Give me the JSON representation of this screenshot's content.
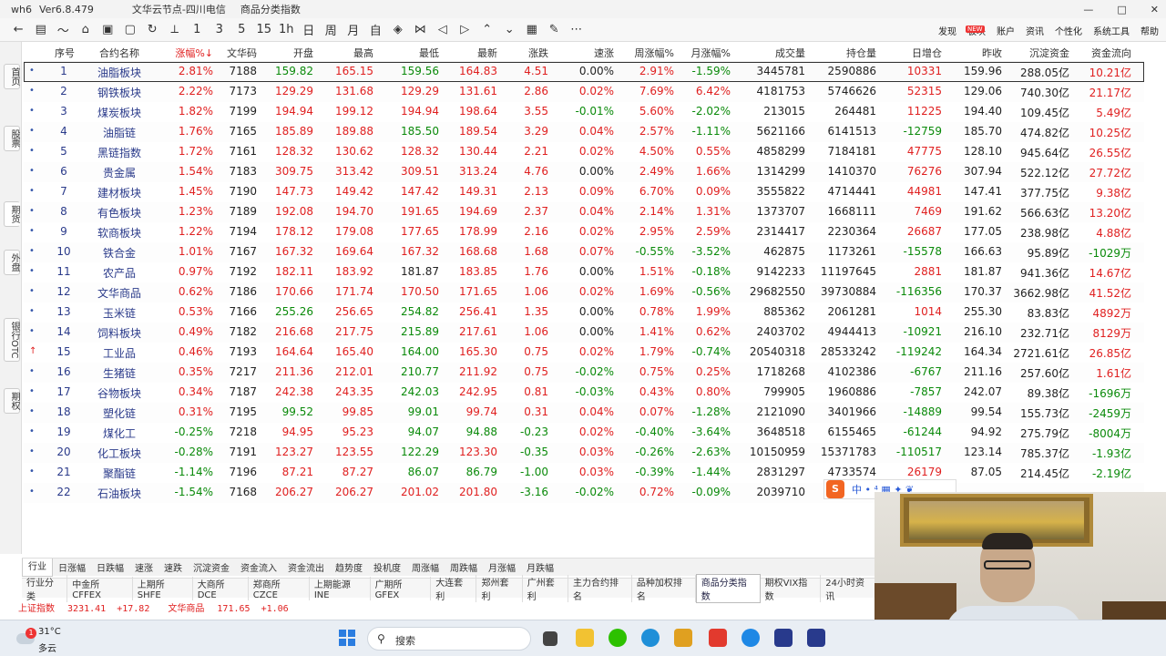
{
  "titlebar": {
    "app": "wh6",
    "version": "Ver6.8.479",
    "node": "文华云节点-四川电信",
    "page": "商品分类指数",
    "min": "—",
    "max": "□",
    "close": "✕"
  },
  "toolbar": {
    "icons": [
      "←",
      "▤",
      "〜",
      "⌂",
      "▣",
      "▢",
      "↻",
      "⟂",
      "1",
      "3",
      "5",
      "15",
      "1h",
      "日",
      "周",
      "月",
      "自",
      "◈",
      "⋈",
      "◁",
      "▷",
      "⌃",
      "⌄",
      "▦",
      "✎",
      "⋯"
    ],
    "right_menu": [
      "发现",
      "板块",
      "账户",
      "资讯",
      "个性化",
      "系统工具",
      "帮助"
    ],
    "badge": "NEW"
  },
  "left_tabs": [
    "首页",
    "股票",
    "期货",
    "外盘",
    "银行OTC",
    "期权"
  ],
  "columns": [
    "序号",
    "合约名称",
    "涨幅%↓",
    "文华码",
    "开盘",
    "最高",
    "最低",
    "最新",
    "涨跌",
    "速涨",
    "周涨幅%",
    "月涨幅%",
    "成交量",
    "持仓量",
    "日增仓",
    "昨收",
    "沉淀资金",
    "资金流向"
  ],
  "rows": [
    {
      "no": "1",
      "name": "油脂板块",
      "chg": "2.81%",
      "code": "7188",
      "open": "159.82",
      "high": "165.15",
      "low": "159.56",
      "last": "164.83",
      "diff": "4.51",
      "speed": "0.00%",
      "week": "2.91%",
      "month": "-1.59%",
      "vol": "3445781",
      "oi": "2590886",
      "doi": "10331",
      "prev": "159.96",
      "fund": "288.05亿",
      "flow": "10.21亿"
    },
    {
      "no": "2",
      "name": "钢铁板块",
      "chg": "2.22%",
      "code": "7173",
      "open": "129.29",
      "high": "131.68",
      "low": "129.29",
      "last": "131.61",
      "diff": "2.86",
      "speed": "0.02%",
      "week": "7.69%",
      "month": "6.42%",
      "vol": "4181753",
      "oi": "5746626",
      "doi": "52315",
      "prev": "129.06",
      "fund": "740.30亿",
      "flow": "21.17亿"
    },
    {
      "no": "3",
      "name": "煤炭板块",
      "chg": "1.82%",
      "code": "7199",
      "open": "194.94",
      "high": "199.12",
      "low": "194.94",
      "last": "198.64",
      "diff": "3.55",
      "speed": "-0.01%",
      "week": "5.60%",
      "month": "-2.02%",
      "vol": "213015",
      "oi": "264481",
      "doi": "11225",
      "prev": "194.40",
      "fund": "109.45亿",
      "flow": "5.49亿"
    },
    {
      "no": "4",
      "name": "油脂链",
      "chg": "1.76%",
      "code": "7165",
      "open": "185.89",
      "high": "189.88",
      "low": "185.50",
      "last": "189.54",
      "diff": "3.29",
      "speed": "0.04%",
      "week": "2.57%",
      "month": "-1.11%",
      "vol": "5621166",
      "oi": "6141513",
      "doi": "-12759",
      "prev": "185.70",
      "fund": "474.82亿",
      "flow": "10.25亿"
    },
    {
      "no": "5",
      "name": "黑链指数",
      "chg": "1.72%",
      "code": "7161",
      "open": "128.32",
      "high": "130.62",
      "low": "128.32",
      "last": "130.44",
      "diff": "2.21",
      "speed": "0.02%",
      "week": "4.50%",
      "month": "0.55%",
      "vol": "4858299",
      "oi": "7184181",
      "doi": "47775",
      "prev": "128.10",
      "fund": "945.64亿",
      "flow": "26.55亿"
    },
    {
      "no": "6",
      "name": "贵金属",
      "chg": "1.54%",
      "code": "7183",
      "open": "309.75",
      "high": "313.42",
      "low": "309.51",
      "last": "313.24",
      "diff": "4.76",
      "speed": "0.00%",
      "week": "2.49%",
      "month": "1.66%",
      "vol": "1314299",
      "oi": "1410370",
      "doi": "76276",
      "prev": "307.94",
      "fund": "522.12亿",
      "flow": "27.72亿"
    },
    {
      "no": "7",
      "name": "建材板块",
      "chg": "1.45%",
      "code": "7190",
      "open": "147.73",
      "high": "149.42",
      "low": "147.42",
      "last": "149.31",
      "diff": "2.13",
      "speed": "0.09%",
      "week": "6.70%",
      "month": "0.09%",
      "vol": "3555822",
      "oi": "4714441",
      "doi": "44981",
      "prev": "147.41",
      "fund": "377.75亿",
      "flow": "9.38亿"
    },
    {
      "no": "8",
      "name": "有色板块",
      "chg": "1.23%",
      "code": "7189",
      "open": "192.08",
      "high": "194.70",
      "low": "191.65",
      "last": "194.69",
      "diff": "2.37",
      "speed": "0.04%",
      "week": "2.14%",
      "month": "1.31%",
      "vol": "1373707",
      "oi": "1668111",
      "doi": "7469",
      "prev": "191.62",
      "fund": "566.63亿",
      "flow": "13.20亿"
    },
    {
      "no": "9",
      "name": "软商板块",
      "chg": "1.22%",
      "code": "7194",
      "open": "178.12",
      "high": "179.08",
      "low": "177.65",
      "last": "178.99",
      "diff": "2.16",
      "speed": "0.02%",
      "week": "2.95%",
      "month": "2.59%",
      "vol": "2314417",
      "oi": "2230364",
      "doi": "26687",
      "prev": "177.05",
      "fund": "238.98亿",
      "flow": "4.88亿"
    },
    {
      "no": "10",
      "name": "铁合金",
      "chg": "1.01%",
      "code": "7167",
      "open": "167.32",
      "high": "169.64",
      "low": "167.32",
      "last": "168.68",
      "diff": "1.68",
      "speed": "0.07%",
      "week": "-0.55%",
      "month": "-3.52%",
      "vol": "462875",
      "oi": "1173261",
      "doi": "-15578",
      "prev": "166.63",
      "fund": "95.89亿",
      "flow": "-1029万"
    },
    {
      "no": "11",
      "name": "农产品",
      "chg": "0.97%",
      "code": "7192",
      "open": "182.11",
      "high": "183.92",
      "low": "181.87",
      "last": "183.85",
      "diff": "1.76",
      "speed": "0.00%",
      "week": "1.51%",
      "month": "-0.18%",
      "vol": "9142233",
      "oi": "11197645",
      "doi": "2881",
      "prev": "181.87",
      "fund": "941.36亿",
      "flow": "14.67亿"
    },
    {
      "no": "12",
      "name": "文华商品",
      "chg": "0.62%",
      "code": "7186",
      "open": "170.66",
      "high": "171.74",
      "low": "170.50",
      "last": "171.65",
      "diff": "1.06",
      "speed": "0.02%",
      "week": "1.69%",
      "month": "-0.56%",
      "vol": "29682550",
      "oi": "39730884",
      "doi": "-116356",
      "prev": "170.37",
      "fund": "3662.98亿",
      "flow": "41.52亿"
    },
    {
      "no": "13",
      "name": "玉米链",
      "chg": "0.53%",
      "code": "7166",
      "open": "255.26",
      "high": "256.65",
      "low": "254.82",
      "last": "256.41",
      "diff": "1.35",
      "speed": "0.00%",
      "week": "0.78%",
      "month": "1.99%",
      "vol": "885362",
      "oi": "2061281",
      "doi": "1014",
      "prev": "255.30",
      "fund": "83.83亿",
      "flow": "4892万"
    },
    {
      "no": "14",
      "name": "饲料板块",
      "chg": "0.49%",
      "code": "7182",
      "open": "216.68",
      "high": "217.75",
      "low": "215.89",
      "last": "217.61",
      "diff": "1.06",
      "speed": "0.00%",
      "week": "1.41%",
      "month": "0.62%",
      "vol": "2403702",
      "oi": "4944413",
      "doi": "-10921",
      "prev": "216.10",
      "fund": "232.71亿",
      "flow": "8129万"
    },
    {
      "no": "15",
      "name": "工业品",
      "chg": "0.46%",
      "code": "7193",
      "open": "164.64",
      "high": "165.40",
      "low": "164.00",
      "last": "165.30",
      "diff": "0.75",
      "speed": "0.02%",
      "week": "1.79%",
      "month": "-0.74%",
      "vol": "20540318",
      "oi": "28533242",
      "doi": "-119242",
      "prev": "164.34",
      "fund": "2721.61亿",
      "flow": "26.85亿"
    },
    {
      "no": "16",
      "name": "生猪链",
      "chg": "0.35%",
      "code": "7217",
      "open": "211.36",
      "high": "212.01",
      "low": "210.77",
      "last": "211.92",
      "diff": "0.75",
      "speed": "-0.02%",
      "week": "0.75%",
      "month": "0.25%",
      "vol": "1718268",
      "oi": "4102386",
      "doi": "-6767",
      "prev": "211.16",
      "fund": "257.60亿",
      "flow": "1.61亿"
    },
    {
      "no": "17",
      "name": "谷物板块",
      "chg": "0.34%",
      "code": "7187",
      "open": "242.38",
      "high": "243.35",
      "low": "242.03",
      "last": "242.95",
      "diff": "0.81",
      "speed": "-0.03%",
      "week": "0.43%",
      "month": "0.80%",
      "vol": "799905",
      "oi": "1960886",
      "doi": "-7857",
      "prev": "242.07",
      "fund": "89.38亿",
      "flow": "-1696万"
    },
    {
      "no": "18",
      "name": "塑化链",
      "chg": "0.31%",
      "code": "7195",
      "open": "99.52",
      "high": "99.85",
      "low": "99.01",
      "last": "99.74",
      "diff": "0.31",
      "speed": "0.04%",
      "week": "0.07%",
      "month": "-1.28%",
      "vol": "2121090",
      "oi": "3401966",
      "doi": "-14889",
      "prev": "99.54",
      "fund": "155.73亿",
      "flow": "-2459万"
    },
    {
      "no": "19",
      "name": "煤化工",
      "chg": "-0.25%",
      "code": "7218",
      "open": "94.95",
      "high": "95.23",
      "low": "94.07",
      "last": "94.88",
      "diff": "-0.23",
      "speed": "0.02%",
      "week": "-0.40%",
      "month": "-3.64%",
      "vol": "3648518",
      "oi": "6155465",
      "doi": "-61244",
      "prev": "94.92",
      "fund": "275.79亿",
      "flow": "-8004万"
    },
    {
      "no": "20",
      "name": "化工板块",
      "chg": "-0.28%",
      "code": "7191",
      "open": "123.27",
      "high": "123.55",
      "low": "122.29",
      "last": "123.30",
      "diff": "-0.35",
      "speed": "0.03%",
      "week": "-0.26%",
      "month": "-2.63%",
      "vol": "10150959",
      "oi": "15371783",
      "doi": "-110517",
      "prev": "123.14",
      "fund": "785.37亿",
      "flow": "-1.93亿"
    },
    {
      "no": "21",
      "name": "聚酯链",
      "chg": "-1.14%",
      "code": "7196",
      "open": "87.21",
      "high": "87.27",
      "low": "86.07",
      "last": "86.79",
      "diff": "-1.00",
      "speed": "0.03%",
      "week": "-0.39%",
      "month": "-1.44%",
      "vol": "2831297",
      "oi": "4733574",
      "doi": "26179",
      "prev": "87.05",
      "fund": "214.45亿",
      "flow": "-2.19亿"
    },
    {
      "no": "22",
      "name": "石油板块",
      "chg": "-1.54%",
      "code": "7168",
      "open": "206.27",
      "high": "206.27",
      "low": "201.02",
      "last": "201.80",
      "diff": "-3.16",
      "speed": "-0.02%",
      "week": "0.72%",
      "month": "-0.09%",
      "vol": "2039710",
      "oi": "",
      "doi": "",
      "prev": "",
      "fund": "",
      "flow": ""
    }
  ],
  "sub_tabs": [
    "行业",
    "日涨幅",
    "日跌幅",
    "速涨",
    "速跌",
    "沉淀资金",
    "资金流入",
    "资金流出",
    "趋势度",
    "投机度",
    "周涨幅",
    "周跌幅",
    "月涨幅",
    "月跌幅"
  ],
  "market_tabs": [
    "行业分类",
    "中金所CFFEX",
    "上期所SHFE",
    "大商所DCE",
    "郑商所CZCE",
    "上期能源INE",
    "广期所GFEX",
    "大连套利",
    "郑州套利",
    "广州套利",
    "主力合约排名",
    "品种加权排名",
    "商品分类指数",
    "期权VIX指数",
    "24小时资讯"
  ],
  "status": {
    "sh_label": "上证指数",
    "sh_value": "3231.41",
    "sh_change": "+17.82",
    "wh_label": "文华商品",
    "wh_value": "171.65",
    "wh_change": "+1.06"
  },
  "taskbar": {
    "weather_temp": "31°C",
    "weather_cond": "多云",
    "weather_badge": "1",
    "search_placeholder": "搜索"
  },
  "ime": {
    "logo": "S",
    "text": "中 • ⁴ ▦ ✦ ❦"
  },
  "colors": {
    "up": "#e02020",
    "down": "#0a8a0a",
    "accent": "#2b7de0"
  }
}
